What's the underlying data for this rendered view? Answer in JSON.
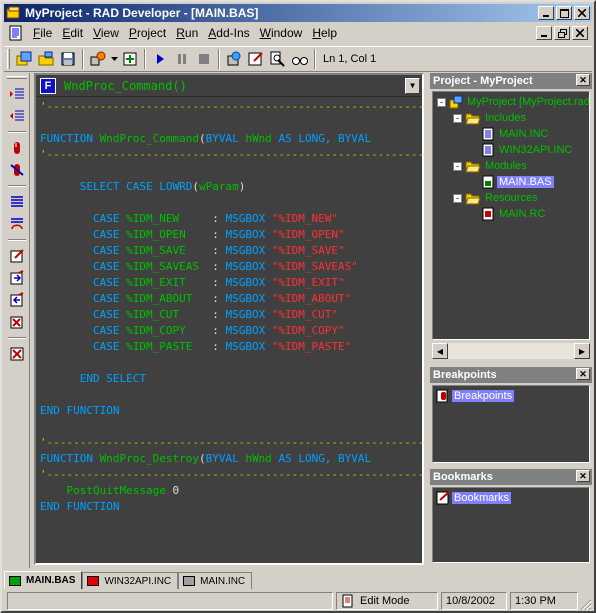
{
  "window": {
    "title": "MyProject - RAD Developer - [MAIN.BAS]",
    "colors": {
      "titlebar_start": "#0a246a",
      "titlebar_end": "#a6caf0",
      "editor_bg": "#404040"
    }
  },
  "menu": {
    "items": [
      {
        "label": "File"
      },
      {
        "label": "Edit"
      },
      {
        "label": "View"
      },
      {
        "label": "Project"
      },
      {
        "label": "Run"
      },
      {
        "label": "Add-Ins"
      },
      {
        "label": "Window"
      },
      {
        "label": "Help"
      }
    ]
  },
  "toolbar": {
    "status_text": "Ln 1, Col 1"
  },
  "editor": {
    "procedure": "WndProc_Command()",
    "lines": [
      {
        "parts": [
          {
            "t": "sep",
            "v": "'-----------------------------------------------------------------"
          }
        ]
      },
      {
        "parts": []
      },
      {
        "parts": [
          {
            "t": "kw",
            "v": "FUNCTION "
          },
          {
            "t": "id",
            "v": "WndProc_Command"
          },
          {
            "t": "df",
            "v": "("
          },
          {
            "t": "kw",
            "v": "BYVAL "
          },
          {
            "t": "id",
            "v": "hWnd "
          },
          {
            "t": "kw",
            "v": "AS LONG, BYVAL"
          }
        ]
      },
      {
        "parts": [
          {
            "t": "sep",
            "v": "'-----------------------------------------------------------------"
          }
        ]
      },
      {
        "parts": []
      },
      {
        "parts": [
          {
            "t": "df",
            "v": "      "
          },
          {
            "t": "kw",
            "v": "SELECT CASE LOWRD"
          },
          {
            "t": "df",
            "v": "("
          },
          {
            "t": "id",
            "v": "wParam"
          },
          {
            "t": "df",
            "v": ")"
          }
        ]
      },
      {
        "parts": []
      },
      {
        "parts": [
          {
            "t": "df",
            "v": "        "
          },
          {
            "t": "kw",
            "v": "CASE "
          },
          {
            "t": "id",
            "v": "%IDM_NEW     "
          },
          {
            "t": "df",
            "v": ": "
          },
          {
            "t": "kw",
            "v": "MSGBOX "
          },
          {
            "t": "st",
            "v": "\"%IDM_NEW\""
          }
        ]
      },
      {
        "parts": [
          {
            "t": "df",
            "v": "        "
          },
          {
            "t": "kw",
            "v": "CASE "
          },
          {
            "t": "id",
            "v": "%IDM_OPEN    "
          },
          {
            "t": "df",
            "v": ": "
          },
          {
            "t": "kw",
            "v": "MSGBOX "
          },
          {
            "t": "st",
            "v": "\"%IDM_OPEN\""
          }
        ]
      },
      {
        "parts": [
          {
            "t": "df",
            "v": "        "
          },
          {
            "t": "kw",
            "v": "CASE "
          },
          {
            "t": "id",
            "v": "%IDM_SAVE    "
          },
          {
            "t": "df",
            "v": ": "
          },
          {
            "t": "kw",
            "v": "MSGBOX "
          },
          {
            "t": "st",
            "v": "\"%IDM_SAVE\""
          }
        ]
      },
      {
        "parts": [
          {
            "t": "df",
            "v": "        "
          },
          {
            "t": "kw",
            "v": "CASE "
          },
          {
            "t": "id",
            "v": "%IDM_SAVEAS  "
          },
          {
            "t": "df",
            "v": ": "
          },
          {
            "t": "kw",
            "v": "MSGBOX "
          },
          {
            "t": "st",
            "v": "\"%IDM_SAVEAS\""
          }
        ]
      },
      {
        "parts": [
          {
            "t": "df",
            "v": "        "
          },
          {
            "t": "kw",
            "v": "CASE "
          },
          {
            "t": "id",
            "v": "%IDM_EXIT    "
          },
          {
            "t": "df",
            "v": ": "
          },
          {
            "t": "kw",
            "v": "MSGBOX "
          },
          {
            "t": "st",
            "v": "\"%IDM_EXIT\""
          }
        ]
      },
      {
        "parts": [
          {
            "t": "df",
            "v": "        "
          },
          {
            "t": "kw",
            "v": "CASE "
          },
          {
            "t": "id",
            "v": "%IDM_ABOUT   "
          },
          {
            "t": "df",
            "v": ": "
          },
          {
            "t": "kw",
            "v": "MSGBOX "
          },
          {
            "t": "st",
            "v": "\"%IDM_ABOUT\""
          }
        ]
      },
      {
        "parts": [
          {
            "t": "df",
            "v": "        "
          },
          {
            "t": "kw",
            "v": "CASE "
          },
          {
            "t": "id",
            "v": "%IDM_CUT     "
          },
          {
            "t": "df",
            "v": ": "
          },
          {
            "t": "kw",
            "v": "MSGBOX "
          },
          {
            "t": "st",
            "v": "\"%IDM_CUT\""
          }
        ]
      },
      {
        "parts": [
          {
            "t": "df",
            "v": "        "
          },
          {
            "t": "kw",
            "v": "CASE "
          },
          {
            "t": "id",
            "v": "%IDM_COPY    "
          },
          {
            "t": "df",
            "v": ": "
          },
          {
            "t": "kw",
            "v": "MSGBOX "
          },
          {
            "t": "st",
            "v": "\"%IDM_COPY\""
          }
        ]
      },
      {
        "parts": [
          {
            "t": "df",
            "v": "        "
          },
          {
            "t": "kw",
            "v": "CASE "
          },
          {
            "t": "id",
            "v": "%IDM_PASTE   "
          },
          {
            "t": "df",
            "v": ": "
          },
          {
            "t": "kw",
            "v": "MSGBOX "
          },
          {
            "t": "st",
            "v": "\"%IDM_PASTE\""
          }
        ]
      },
      {
        "parts": []
      },
      {
        "parts": [
          {
            "t": "df",
            "v": "      "
          },
          {
            "t": "kw",
            "v": "END SELECT"
          }
        ]
      },
      {
        "parts": []
      },
      {
        "parts": [
          {
            "t": "kw",
            "v": "END FUNCTION"
          }
        ]
      },
      {
        "parts": []
      },
      {
        "parts": [
          {
            "t": "sep",
            "v": "'-----------------------------------------------------------------"
          }
        ]
      },
      {
        "parts": [
          {
            "t": "kw",
            "v": "FUNCTION "
          },
          {
            "t": "id",
            "v": "WndProc_Destroy"
          },
          {
            "t": "df",
            "v": "("
          },
          {
            "t": "kw",
            "v": "BYVAL "
          },
          {
            "t": "id",
            "v": "hWnd "
          },
          {
            "t": "kw",
            "v": "AS LONG, BYVAL"
          }
        ]
      },
      {
        "parts": [
          {
            "t": "sep",
            "v": "'-----------------------------------------------------------------"
          }
        ]
      },
      {
        "parts": [
          {
            "t": "df",
            "v": "    "
          },
          {
            "t": "id",
            "v": "PostQuitMessage "
          },
          {
            "t": "df",
            "v": "0"
          }
        ]
      },
      {
        "parts": [
          {
            "t": "kw",
            "v": "END FUNCTION"
          }
        ]
      }
    ]
  },
  "project_panel": {
    "title": "Project - MyProject",
    "tree": [
      {
        "label": "MyProject [MyProject.rad]",
        "level": 0,
        "icon": "project-icon",
        "expander": "-",
        "selected": false
      },
      {
        "label": "Includes",
        "level": 1,
        "icon": "folder-open-icon",
        "expander": "-",
        "selected": false
      },
      {
        "label": "MAIN.INC",
        "level": 2,
        "icon": "file-icon",
        "expander": "",
        "selected": false
      },
      {
        "label": "WIN32API.INC",
        "level": 2,
        "icon": "file-icon",
        "expander": "",
        "selected": false
      },
      {
        "label": "Modules",
        "level": 1,
        "icon": "folder-open-icon",
        "expander": "-",
        "selected": false
      },
      {
        "label": "MAIN.BAS",
        "level": 2,
        "icon": "module-icon",
        "expander": "",
        "selected": true
      },
      {
        "label": "Resources",
        "level": 1,
        "icon": "folder-open-icon",
        "expander": "-",
        "selected": false
      },
      {
        "label": "MAIN.RC",
        "level": 2,
        "icon": "resource-icon",
        "expander": "",
        "selected": false
      }
    ]
  },
  "breakpoints_panel": {
    "title": "Breakpoints",
    "item": "Breakpoints"
  },
  "bookmarks_panel": {
    "title": "Bookmarks",
    "item": "Bookmarks"
  },
  "tabs": [
    {
      "label": "MAIN.BAS",
      "active": true,
      "icon_color": "#00a000"
    },
    {
      "label": "WIN32API.INC",
      "active": false,
      "icon_color": "#e00000"
    },
    {
      "label": "MAIN.INC",
      "active": false,
      "icon_color": "#a0a0a0"
    }
  ],
  "statusbar": {
    "mode": "Edit Mode",
    "date": "10/8/2002",
    "time": "1:30 PM"
  }
}
